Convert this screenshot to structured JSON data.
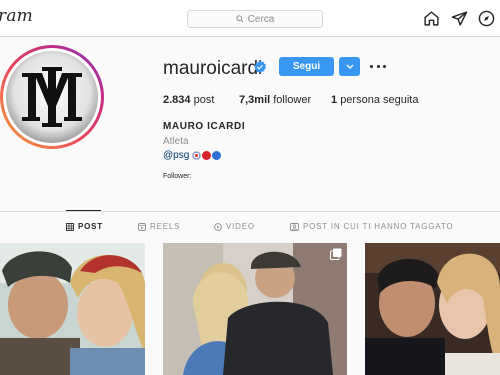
{
  "nav": {
    "logo": "ram",
    "search_placeholder": "Cerca"
  },
  "profile": {
    "username": "mauroicardi",
    "follow_label": "Segui",
    "stats": {
      "posts_count": "2.834",
      "posts_label": "post",
      "followers_count": "7,3mil",
      "followers_label": "follower",
      "following_count": "1",
      "following_label": "persona seguita"
    },
    "full_name": "MAURO ICARDI",
    "category": "Atleta",
    "bio_link": "@psg",
    "followed_by": "Follower:"
  },
  "tabs": [
    {
      "label": "POST",
      "icon": "grid-icon"
    },
    {
      "label": "REELS",
      "icon": "reels-icon"
    },
    {
      "label": "VIDEO",
      "icon": "video-icon"
    },
    {
      "label": "POST IN CUI TI HANNO TAGGATO",
      "icon": "tagged-icon"
    }
  ],
  "colors": {
    "accent": "#3897f0",
    "verified": "#3897f0",
    "link": "#00376b"
  }
}
